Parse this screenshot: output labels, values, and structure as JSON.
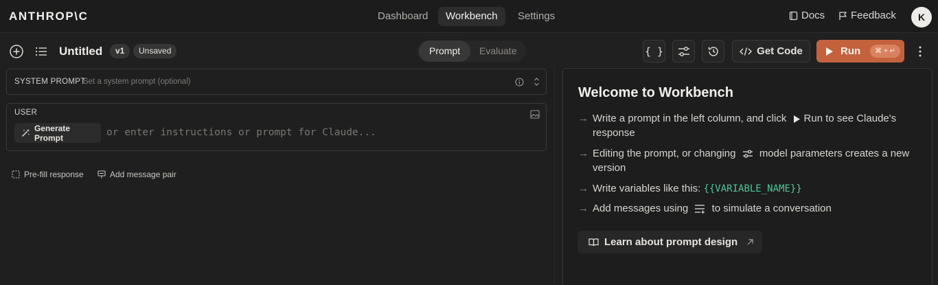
{
  "brand": {
    "logo_text": "ANTHROP\\C"
  },
  "nav": {
    "tabs": [
      {
        "label": "Dashboard"
      },
      {
        "label": "Workbench"
      },
      {
        "label": "Settings"
      }
    ],
    "active_tab": "Workbench",
    "docs_label": "Docs",
    "feedback_label": "Feedback",
    "avatar_initial": "K"
  },
  "toolbar": {
    "title": "Untitled",
    "version_badge": "v1",
    "status_badge": "Unsaved",
    "modes": [
      "Prompt",
      "Evaluate"
    ],
    "active_mode": "Prompt",
    "get_code_label": "Get Code",
    "run_label": "Run",
    "run_shortcut": "⌘ + ↵"
  },
  "editor": {
    "system_prompt_label": "SYSTEM PROMPT",
    "system_prompt_placeholder": "Set a system prompt (optional)",
    "user_label": "USER",
    "generate_prompt_label": "Generate Prompt",
    "user_placeholder": "or enter instructions or prompt for Claude...",
    "prefill_label": "Pre-fill response",
    "add_pair_label": "Add message pair"
  },
  "welcome": {
    "title": "Welcome to Workbench",
    "step1_a": "Write a prompt in the left column, and click",
    "step1_b": "Run to see Claude's response",
    "step2_a": "Editing the prompt, or changing",
    "step2_b": "model parameters creates a new version",
    "step3_a": "Write variables like this:",
    "step3_code": "{{VARIABLE_NAME}}",
    "step4_a": "Add messages using",
    "step4_b": "to simulate a conversation",
    "learn_label": "Learn about prompt design"
  },
  "colors": {
    "accent_run": "#c4623e",
    "variable_code": "#4ec79a",
    "background": "#1f1f1f"
  }
}
